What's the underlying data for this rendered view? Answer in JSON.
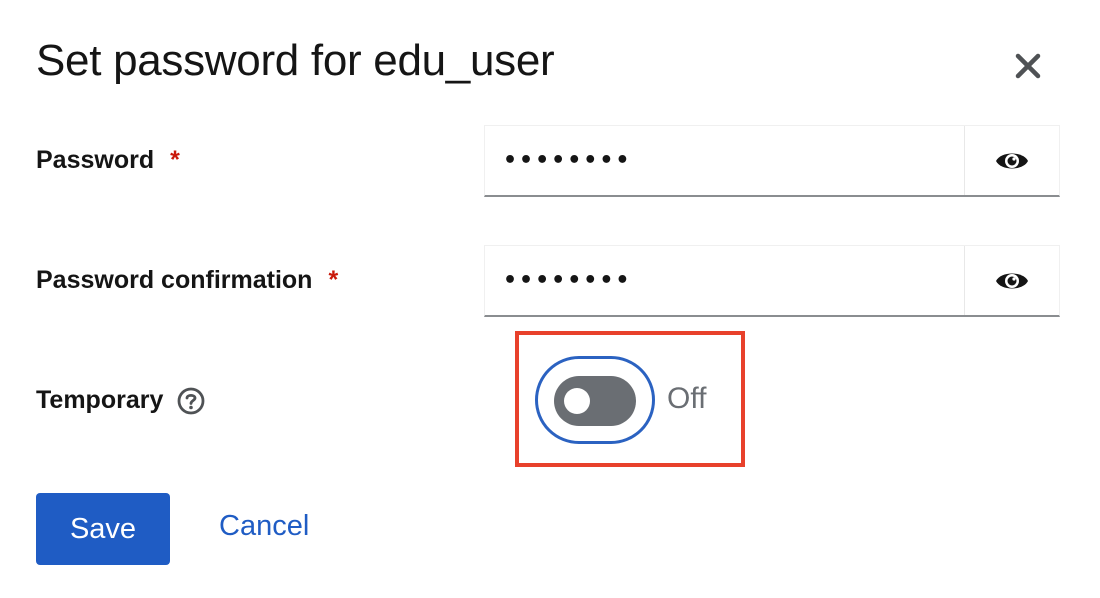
{
  "modal": {
    "title": "Set password for edu_user",
    "close_icon": "close-icon"
  },
  "form": {
    "password": {
      "label": "Password",
      "required_marker": "*",
      "value": "••••••••",
      "toggle_icon": "eye-icon"
    },
    "password_confirmation": {
      "label": "Password confirmation",
      "required_marker": "*",
      "value": "••••••••",
      "toggle_icon": "eye-icon"
    },
    "temporary": {
      "label": "Temporary",
      "help_icon": "question-circle-icon",
      "switch_state": "Off",
      "checked": false
    }
  },
  "actions": {
    "save_label": "Save",
    "cancel_label": "Cancel"
  },
  "colors": {
    "primary": "#1f5cc4",
    "required": "#c9190b",
    "highlight": "#e8412b",
    "toggle_off": "#6a6e73",
    "text": "#151515"
  }
}
